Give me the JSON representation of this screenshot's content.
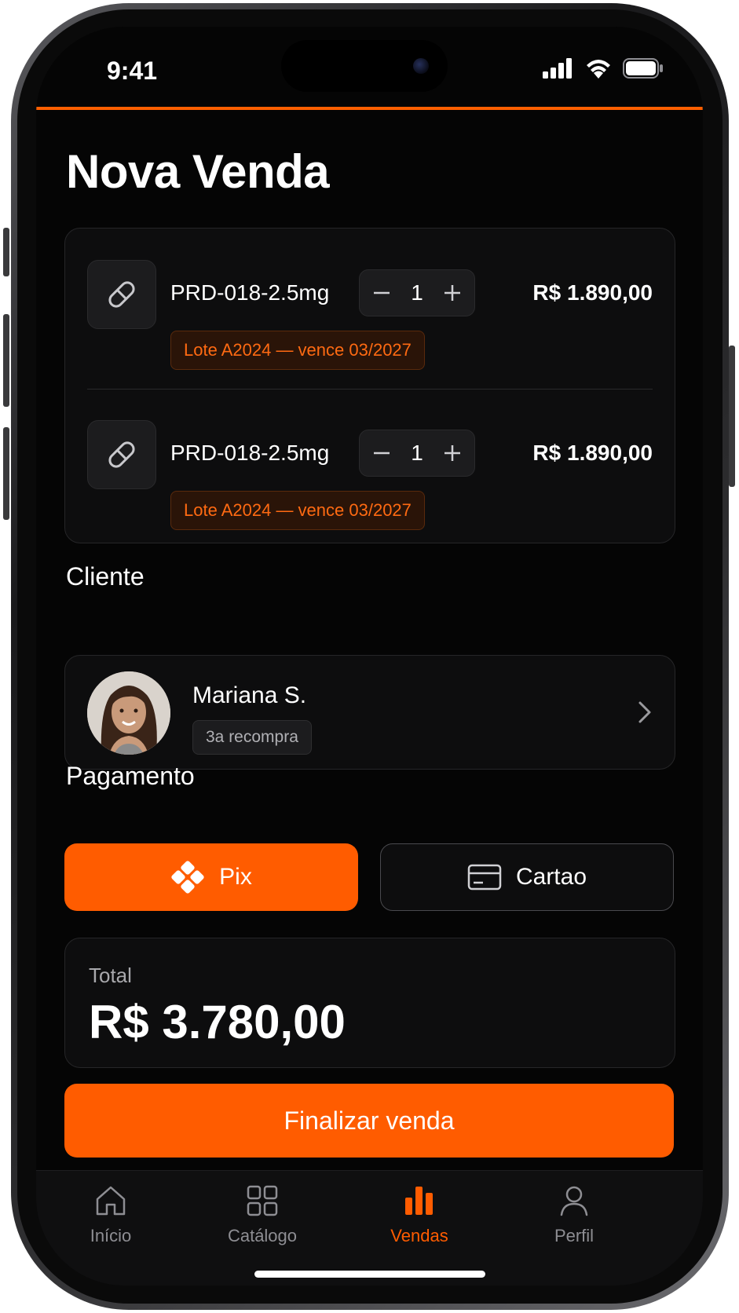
{
  "status_bar": {
    "time": "9:41"
  },
  "page": {
    "title": "Nova Venda"
  },
  "products": [
    {
      "name": "PRD-018-2.5mg",
      "quantity": "1",
      "price": "R$ 1.890,00",
      "lot": "Lote A2024 — vence 03/2027",
      "icon": "capsule-icon"
    },
    {
      "name": "PRD-018-2.5mg",
      "quantity": "1",
      "price": "R$ 1.890,00",
      "lot": "Lote A2024 — vence 03/2027",
      "icon": "capsule-icon"
    }
  ],
  "client": {
    "section_label": "Cliente",
    "name": "Mariana S.",
    "badge": "3a recompra"
  },
  "payment": {
    "section_label": "Pagamento",
    "pix_label": "Pix",
    "card_label": "Cartao",
    "selected": "Pix"
  },
  "total": {
    "label": "Total",
    "value": "R$ 3.780,00"
  },
  "finalize_label": "Finalizar venda",
  "tabs": [
    {
      "label": "Início",
      "icon": "home-icon",
      "active": false
    },
    {
      "label": "Catálogo",
      "icon": "grid-icon",
      "active": false
    },
    {
      "label": "Vendas",
      "icon": "bar-chart-icon",
      "active": true
    },
    {
      "label": "Perfil",
      "icon": "user-icon",
      "active": false
    }
  ],
  "colors": {
    "accent": "#ff5c00",
    "background": "#050505",
    "card": "#0d0d0e",
    "lot_text": "#ff6a12"
  }
}
